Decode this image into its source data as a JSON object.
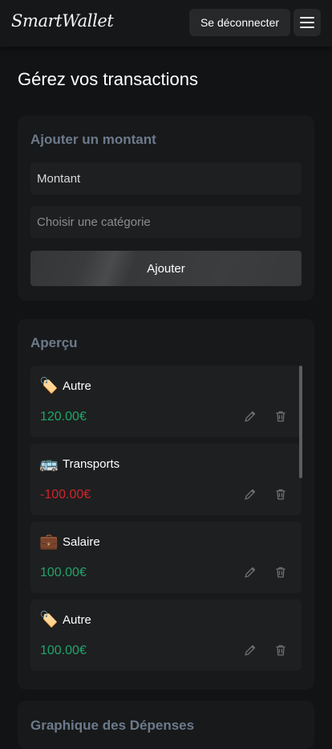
{
  "header": {
    "logo": "SmartWallet",
    "logout_label": "Se déconnecter",
    "menu_icon": "hamburger-icon"
  },
  "page": {
    "title": "Gérez vos transactions"
  },
  "add_card": {
    "title": "Ajouter un montant",
    "amount_value": "Montant",
    "category_placeholder": "Choisir une catégorie",
    "submit_label": "Ajouter"
  },
  "overview": {
    "title": "Aperçu",
    "transactions": [
      {
        "emoji": "🏷️",
        "category": "Autre",
        "amount": "120.00€",
        "sign": "positive"
      },
      {
        "emoji": "🚌",
        "category": "Transports",
        "amount": "-100.00€",
        "sign": "negative"
      },
      {
        "emoji": "💼",
        "category": "Salaire",
        "amount": "100.00€",
        "sign": "positive"
      },
      {
        "emoji": "🏷️",
        "category": "Autre",
        "amount": "100.00€",
        "sign": "positive"
      }
    ]
  },
  "chart_card": {
    "title": "Graphique des Dépenses"
  },
  "colors": {
    "positive": "#1ea56a",
    "negative": "#d2232a",
    "section_title": "#6c7a8c"
  }
}
